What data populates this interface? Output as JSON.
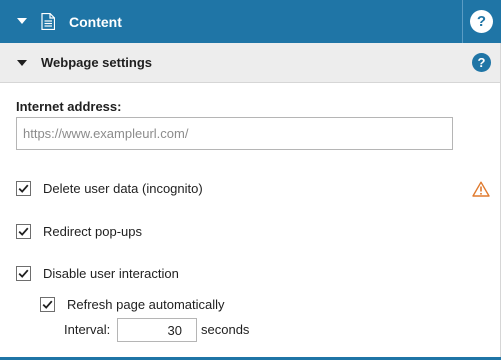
{
  "header": {
    "title": "Content",
    "help": "?",
    "icons": {
      "collapse": "triangle-down-icon",
      "document": "document-icon"
    }
  },
  "section": {
    "title": "Webpage settings",
    "help": "?"
  },
  "url": {
    "label": "Internet address:",
    "placeholder": "https://www.exampleurl.com/",
    "value": ""
  },
  "options": [
    {
      "label": "Delete user data (incognito)",
      "checked": true,
      "warning": true
    },
    {
      "label": "Redirect pop-ups",
      "checked": true
    },
    {
      "label": "Disable user interaction",
      "checked": true
    }
  ],
  "refresh": {
    "label": "Refresh page automatically",
    "checked": true,
    "interval_label": "Interval:",
    "interval_value": "30",
    "unit": "seconds"
  },
  "colors": {
    "accent": "#1f75a6",
    "warning": "#e07a2e",
    "subheader_bg": "#ededed"
  }
}
